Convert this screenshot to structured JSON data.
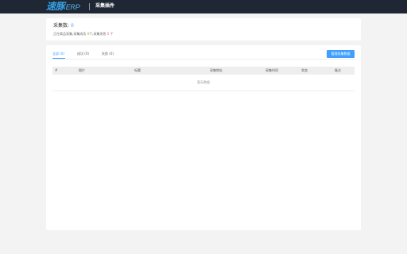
{
  "header": {
    "logo_main": "速豚",
    "logo_sub": "ERP",
    "plugin_title": "采集插件"
  },
  "summary": {
    "total_label": "采集数:",
    "total_value": "0",
    "progress_prefix": "正在商品采集,采集成功",
    "success_count": "0",
    "success_unit": "个,采集失败",
    "fail_count": "0",
    "fail_unit": "个"
  },
  "tabs": [
    {
      "label": "全部 (0)",
      "active": true
    },
    {
      "label": "成功 (0)",
      "active": false
    },
    {
      "label": "失败 (0)",
      "active": false
    }
  ],
  "actions": {
    "manage_label": "管理采集数据"
  },
  "table": {
    "columns": [
      "#",
      "图片",
      "标题",
      "采集地址",
      "采集时间",
      "状态",
      "备注"
    ],
    "empty_text": "暂无数据"
  },
  "colors": {
    "accent": "#409eff",
    "topbar": "#1e2733",
    "success": "#67c23a",
    "fail": "#f56c6c"
  }
}
